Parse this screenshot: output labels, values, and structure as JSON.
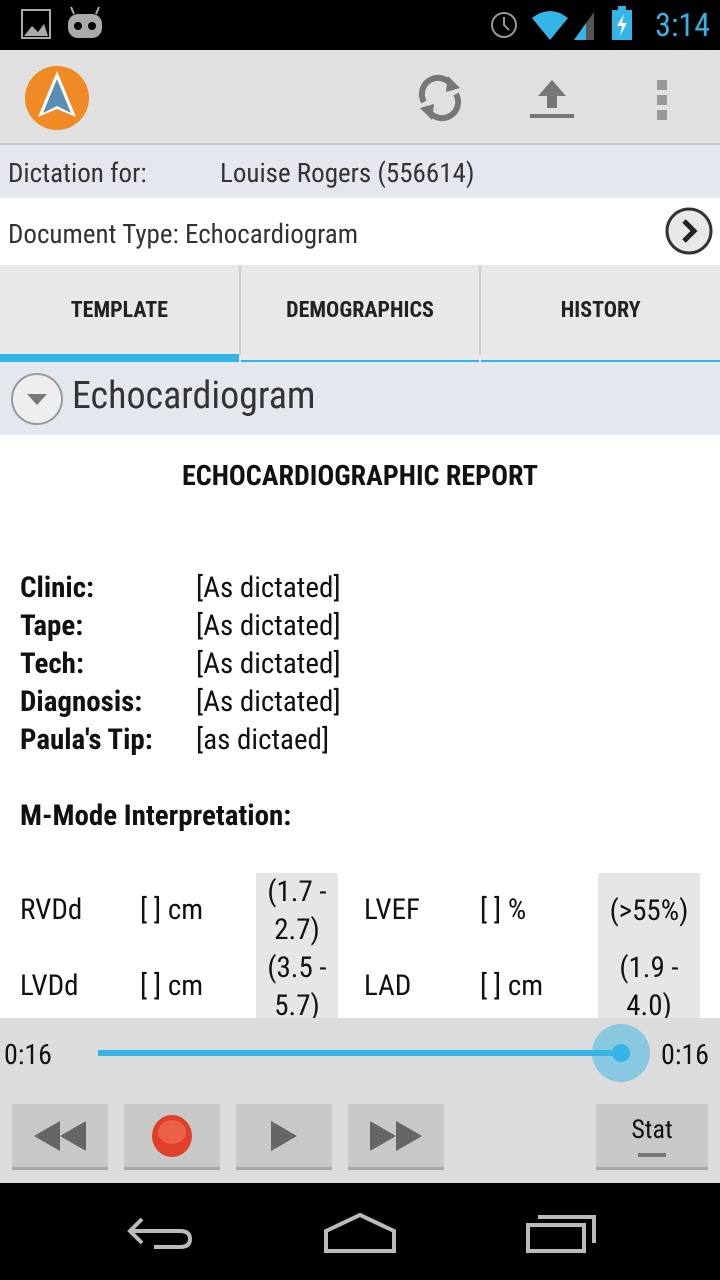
{
  "status_bar": {
    "time": "3:14",
    "icons": [
      "image-icon",
      "cyanogen-icon",
      "alarm-icon",
      "wifi-icon",
      "signal-icon",
      "battery-charging-icon"
    ]
  },
  "action_bar": {
    "icons": [
      "app-logo",
      "sync-icon",
      "upload-icon",
      "overflow-menu-icon"
    ]
  },
  "dictation": {
    "label": "Dictation for:",
    "patient": "Louise Rogers (556614)"
  },
  "document_type": {
    "label": "Document Type: Echocardiogram"
  },
  "tabs": [
    {
      "label": "TEMPLATE",
      "active": true
    },
    {
      "label": "DEMOGRAPHICS",
      "active": false
    },
    {
      "label": "HISTORY",
      "active": false
    }
  ],
  "section": {
    "title": "Echocardiogram"
  },
  "report": {
    "title": "ECHOCARDIOGRAPHIC REPORT",
    "fields": [
      {
        "label": "Clinic:",
        "value": "[As dictated]"
      },
      {
        "label": "Tape:",
        "value": "[As dictated]"
      },
      {
        "label": "Tech:",
        "value": "[As dictated]"
      },
      {
        "label": "Diagnosis:",
        "value": "[As dictated]"
      },
      {
        "label": "Paula's Tip:",
        "value": "[as dictaed]"
      }
    ],
    "mmode_heading": "M-Mode Interpretation:",
    "rows": [
      {
        "m1": "RVDd",
        "v1": "[ ] cm",
        "r1a": "(1.7 -",
        "r1b": "2.7)",
        "m2": "LVEF",
        "v2": "[ ] %",
        "r2a": "(>55%)",
        "r2b": ""
      },
      {
        "m1": "LVDd",
        "v1": "[ ] cm",
        "r1a": "(3.5 -",
        "r1b": "5.7)",
        "m2": "LAD",
        "v2": "[ ] cm",
        "r2a": "(1.9 -",
        "r2b": "4.0)"
      }
    ]
  },
  "player": {
    "elapsed": "0:16",
    "total": "0:16",
    "progress": 1.0,
    "stat_label": "Stat",
    "accent": "#33b5e5",
    "record_color": "#e0402a"
  }
}
